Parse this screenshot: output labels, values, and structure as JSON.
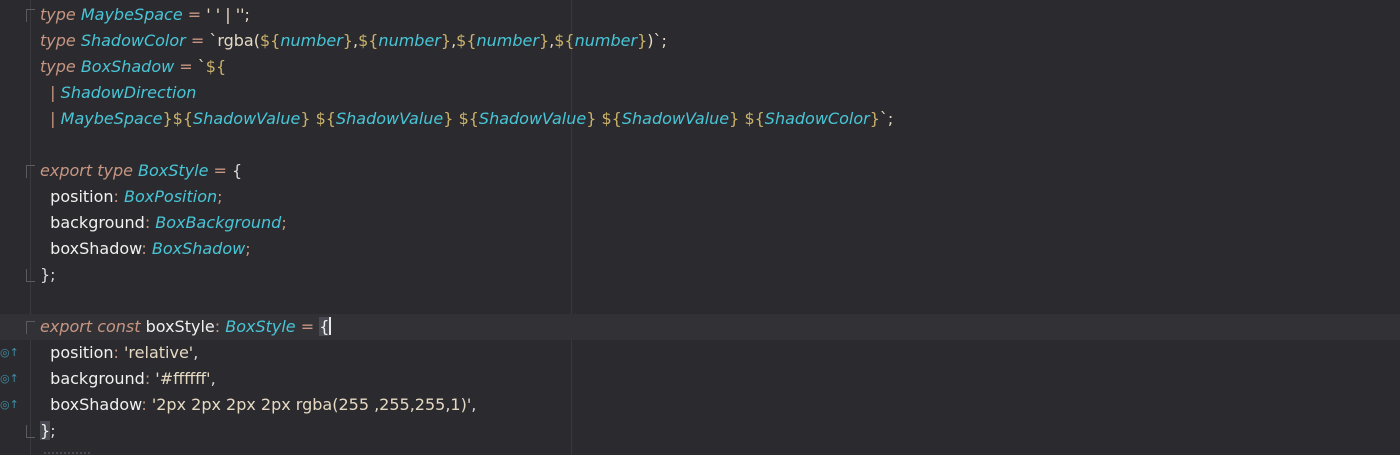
{
  "editor": {
    "theme_colors": {
      "background": "#2b2b2f",
      "keyword": "#c79682",
      "type": "#48c5d6",
      "string": "#e5d9c3",
      "interpolation": "#c9b16a",
      "plain": "#e8e8e8",
      "gutter_marker": "#3f8fa5"
    },
    "gutter_icon": "implements-override-icon",
    "lines": [
      {
        "n": 1,
        "tokens": [
          {
            "c": "t-kw",
            "t": "type "
          },
          {
            "c": "t-type",
            "t": "MaybeSpace"
          },
          {
            "c": "t-op",
            "t": " = "
          },
          {
            "c": "t-str",
            "t": "' ' | '';"
          }
        ]
      },
      {
        "n": 2,
        "tokens": [
          {
            "c": "t-kw",
            "t": "type "
          },
          {
            "c": "t-type",
            "t": "ShadowColor"
          },
          {
            "c": "t-op",
            "t": " = "
          },
          {
            "c": "t-str",
            "t": "`rgba("
          },
          {
            "c": "t-interp",
            "t": "${"
          },
          {
            "c": "t-type",
            "t": "number"
          },
          {
            "c": "t-interp",
            "t": "}"
          },
          {
            "c": "t-str",
            "t": ","
          },
          {
            "c": "t-interp",
            "t": "${"
          },
          {
            "c": "t-type",
            "t": "number"
          },
          {
            "c": "t-interp",
            "t": "}"
          },
          {
            "c": "t-str",
            "t": ","
          },
          {
            "c": "t-interp",
            "t": "${"
          },
          {
            "c": "t-type",
            "t": "number"
          },
          {
            "c": "t-interp",
            "t": "}"
          },
          {
            "c": "t-str",
            "t": ","
          },
          {
            "c": "t-interp",
            "t": "${"
          },
          {
            "c": "t-type",
            "t": "number"
          },
          {
            "c": "t-interp",
            "t": "}"
          },
          {
            "c": "t-str",
            "t": ")`;"
          }
        ]
      },
      {
        "n": 3,
        "tokens": [
          {
            "c": "t-kw",
            "t": "type "
          },
          {
            "c": "t-type",
            "t": "BoxShadow"
          },
          {
            "c": "t-op",
            "t": " = "
          },
          {
            "c": "t-str",
            "t": "`"
          },
          {
            "c": "t-interp",
            "t": "${"
          }
        ]
      },
      {
        "n": 4,
        "tokens": [
          {
            "c": "t-op",
            "t": "  | "
          },
          {
            "c": "t-type",
            "t": "ShadowDirection"
          }
        ]
      },
      {
        "n": 5,
        "tokens": [
          {
            "c": "t-op",
            "t": "  | "
          },
          {
            "c": "t-type",
            "t": "MaybeSpace"
          },
          {
            "c": "t-interp",
            "t": "}${"
          },
          {
            "c": "t-type",
            "t": "ShadowValue"
          },
          {
            "c": "t-interp",
            "t": "}"
          },
          {
            "c": "t-str",
            "t": " "
          },
          {
            "c": "t-interp",
            "t": "${"
          },
          {
            "c": "t-type",
            "t": "ShadowValue"
          },
          {
            "c": "t-interp",
            "t": "}"
          },
          {
            "c": "t-str",
            "t": " "
          },
          {
            "c": "t-interp",
            "t": "${"
          },
          {
            "c": "t-type",
            "t": "ShadowValue"
          },
          {
            "c": "t-interp",
            "t": "}"
          },
          {
            "c": "t-str",
            "t": " "
          },
          {
            "c": "t-interp",
            "t": "${"
          },
          {
            "c": "t-type",
            "t": "ShadowValue"
          },
          {
            "c": "t-interp",
            "t": "}"
          },
          {
            "c": "t-str",
            "t": " "
          },
          {
            "c": "t-interp",
            "t": "${"
          },
          {
            "c": "t-type",
            "t": "ShadowColor"
          },
          {
            "c": "t-interp",
            "t": "}"
          },
          {
            "c": "t-str",
            "t": "`;"
          }
        ]
      },
      {
        "n": 6,
        "tokens": []
      },
      {
        "n": 7,
        "tokens": [
          {
            "c": "t-kw",
            "t": "export type "
          },
          {
            "c": "t-type",
            "t": "BoxStyle"
          },
          {
            "c": "t-op",
            "t": " = "
          },
          {
            "c": "t-punc",
            "t": "{"
          }
        ]
      },
      {
        "n": 8,
        "tokens": [
          {
            "c": "t-prop",
            "t": "  position"
          },
          {
            "c": "t-op",
            "t": ": "
          },
          {
            "c": "t-type",
            "t": "BoxPosition"
          },
          {
            "c": "t-op",
            "t": ";"
          }
        ]
      },
      {
        "n": 9,
        "tokens": [
          {
            "c": "t-prop",
            "t": "  background"
          },
          {
            "c": "t-op",
            "t": ": "
          },
          {
            "c": "t-type",
            "t": "BoxBackground"
          },
          {
            "c": "t-op",
            "t": ";"
          }
        ]
      },
      {
        "n": 10,
        "tokens": [
          {
            "c": "t-prop",
            "t": "  boxShadow"
          },
          {
            "c": "t-op",
            "t": ": "
          },
          {
            "c": "t-type",
            "t": "BoxShadow"
          },
          {
            "c": "t-op",
            "t": ";"
          }
        ]
      },
      {
        "n": 11,
        "tokens": [
          {
            "c": "t-punc",
            "t": "};"
          }
        ]
      },
      {
        "n": 12,
        "tokens": []
      },
      {
        "n": 13,
        "current": true,
        "tokens": [
          {
            "c": "t-kw",
            "t": "export const "
          },
          {
            "c": "t-prop",
            "t": "boxStyle"
          },
          {
            "c": "t-op",
            "t": ": "
          },
          {
            "c": "t-type",
            "t": "BoxStyle"
          },
          {
            "c": "t-op",
            "t": " = "
          },
          {
            "c": "t-brace-hl",
            "t": "{"
          }
        ]
      },
      {
        "n": 14,
        "marker": true,
        "tokens": [
          {
            "c": "t-prop",
            "t": "  position"
          },
          {
            "c": "t-op",
            "t": ": "
          },
          {
            "c": "t-str",
            "t": "'relative'"
          },
          {
            "c": "t-punc",
            "t": ","
          }
        ]
      },
      {
        "n": 15,
        "marker": true,
        "tokens": [
          {
            "c": "t-prop",
            "t": "  background"
          },
          {
            "c": "t-op",
            "t": ": "
          },
          {
            "c": "t-str",
            "t": "'#ffffff'"
          },
          {
            "c": "t-punc",
            "t": ","
          }
        ]
      },
      {
        "n": 16,
        "marker": true,
        "tokens": [
          {
            "c": "t-prop",
            "t": "  boxShadow"
          },
          {
            "c": "t-op",
            "t": ": "
          },
          {
            "c": "t-str",
            "t": "'2px 2px 2px 2px rgba(255 ,255,255,1)'"
          },
          {
            "c": "t-punc",
            "t": ","
          }
        ]
      },
      {
        "n": 17,
        "tokens": [
          {
            "c": "t-brace-hl",
            "t": "}"
          },
          {
            "c": "t-punc",
            "t": ";"
          }
        ]
      }
    ]
  }
}
